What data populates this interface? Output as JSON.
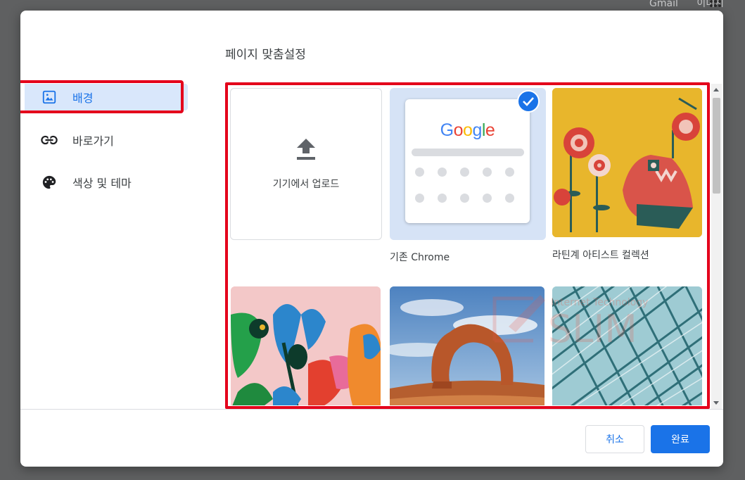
{
  "background_page": {
    "links": [
      "Gmail",
      "이미지"
    ]
  },
  "dialog": {
    "title": "페이지 맞춤설정",
    "nav": [
      {
        "label": "배경",
        "icon": "image-icon",
        "active": true
      },
      {
        "label": "바로가기",
        "icon": "link-icon",
        "active": false
      },
      {
        "label": "색상 및 테마",
        "icon": "palette-icon",
        "active": false
      }
    ],
    "tiles": {
      "upload_label": "기기에서 업로드",
      "chrome_label": "기존 Chrome",
      "chrome_logo": [
        "G",
        "o",
        "o",
        "g",
        "l",
        "e"
      ],
      "artist_label": "라틴계 아티스트 컬렉션"
    },
    "watermark": {
      "line1": "Internet Technology",
      "line2": "SLIM"
    },
    "buttons": {
      "cancel": "취소",
      "done": "완료"
    }
  },
  "colors": {
    "accent": "#1a73e8",
    "highlight_box": "#e4001b",
    "active_nav_bg": "#d9e7fb"
  }
}
